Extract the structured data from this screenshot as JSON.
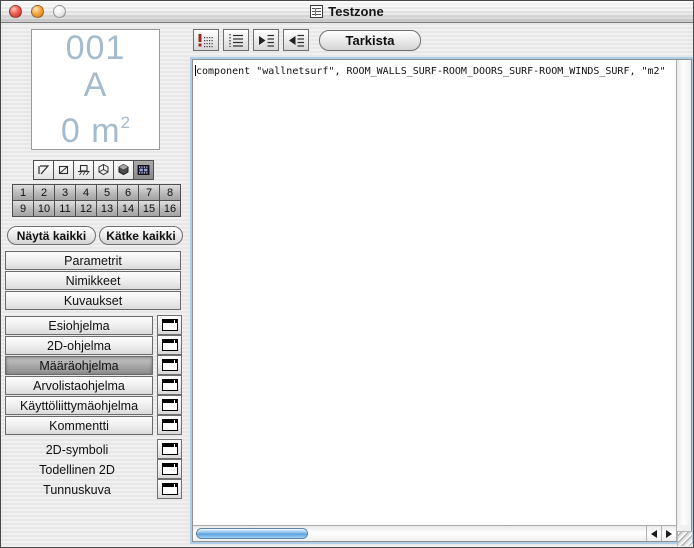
{
  "titlebar": {
    "title": "Testzone"
  },
  "preview": {
    "line1": "001",
    "line2": "A",
    "line3": "0 m",
    "line3_sup": "2"
  },
  "tools": {
    "icon_names": [
      "diagonal-line-tool",
      "crossed-rectangle-tool",
      "object-on-ground-tool",
      "wireframe-solid-tool",
      "shaded-solid-tool",
      "filmstrip-tool"
    ],
    "selected": "filmstrip-tool"
  },
  "layers": {
    "numbers": [
      "1",
      "2",
      "3",
      "4",
      "5",
      "6",
      "7",
      "8",
      "9",
      "10",
      "11",
      "12",
      "13",
      "14",
      "15",
      "16"
    ]
  },
  "actions": {
    "show_all": "Näytä kaikki",
    "hide_all": "Kätke kaikki"
  },
  "sections": {
    "items": [
      "Parametrit",
      "Nimikkeet",
      "Kuvaukset"
    ]
  },
  "scripts": {
    "items": [
      {
        "label": "Esiohjelma",
        "selected": false
      },
      {
        "label": "2D-ohjelma",
        "selected": false
      },
      {
        "label": "Määräohjelma",
        "selected": true
      },
      {
        "label": "Arvolistaohjelma",
        "selected": false
      },
      {
        "label": "Käyttöliittymäohjelma",
        "selected": false
      },
      {
        "label": "Kommentti",
        "selected": false
      }
    ]
  },
  "views": {
    "items": [
      "2D-symboli",
      "Todellinen 2D",
      "Tunnuskuva"
    ]
  },
  "editor_toolbar": {
    "icon_names": [
      "check-syntax-icon",
      "list-format-icon",
      "indent-icon",
      "outdent-icon"
    ],
    "check_label": "Tarkista"
  },
  "editor": {
    "content": "component \"wallnetsurf\", ROOM_WALLS_SURF-ROOM_DOORS_SURF-ROOM_WINDS_SURF, \"m2\""
  },
  "colors": {
    "focus_ring": "#aecde9",
    "scroll_thumb_blue": "#5ba2de",
    "preview_text": "#a4bacd",
    "selected_row_gray": "#9e9e9e"
  }
}
